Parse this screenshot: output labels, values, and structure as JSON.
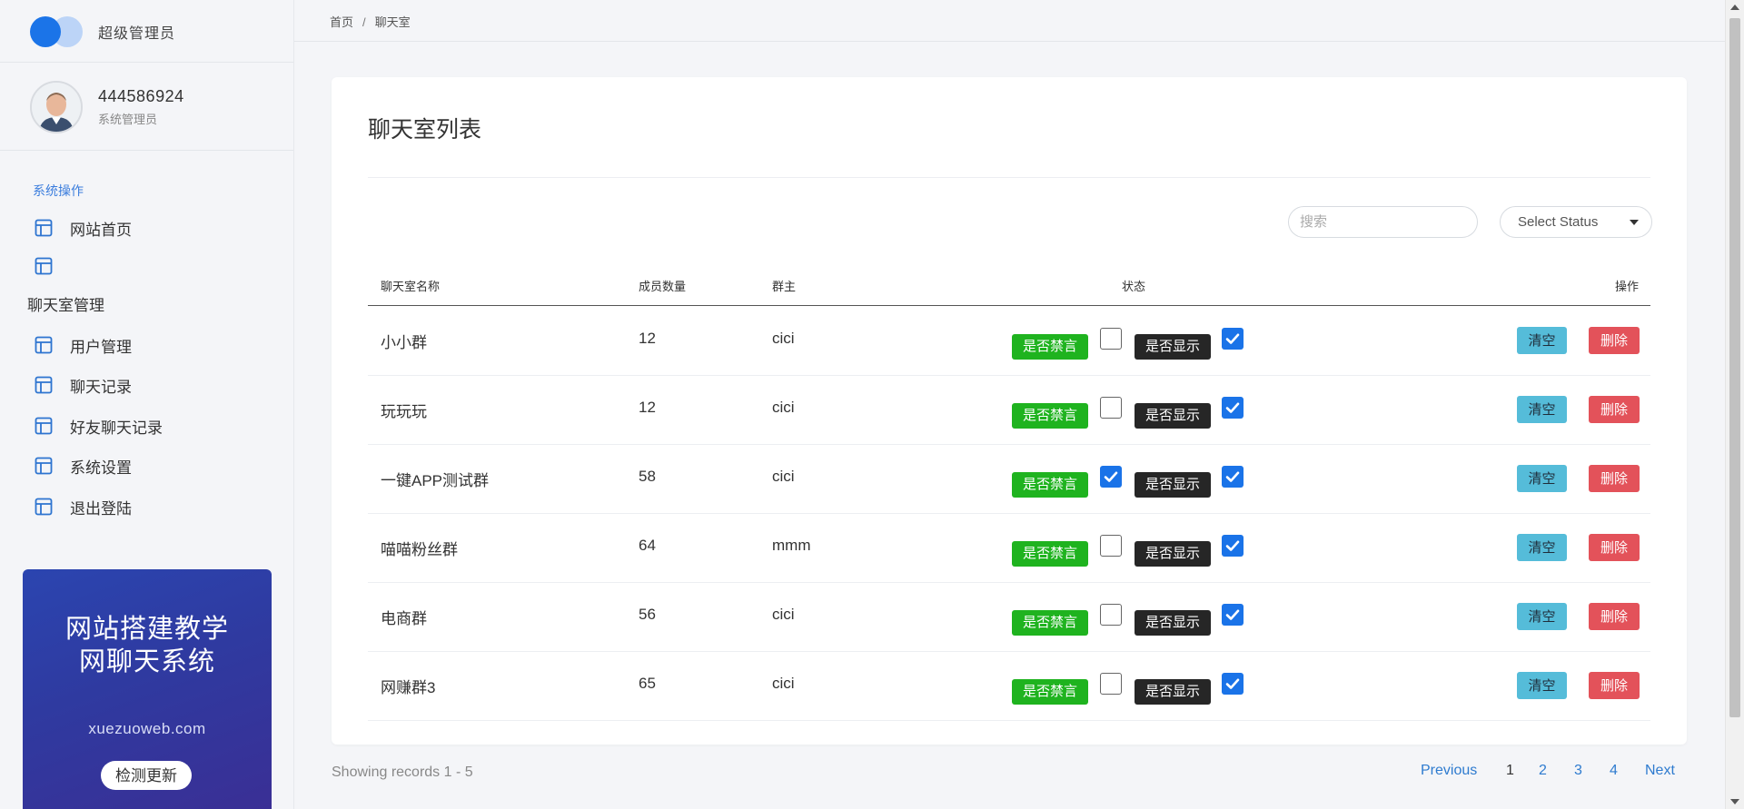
{
  "app": {
    "brand_text": "超级管理员"
  },
  "user": {
    "id": "444586924",
    "role": "系统管理员"
  },
  "sidebar": {
    "section_title": "系统操作",
    "items_top": [
      {
        "label": "网站首页",
        "icon": "layout-icon"
      },
      {
        "label": "",
        "icon": "layout-icon"
      }
    ],
    "group_title": "聊天室管理",
    "items": [
      {
        "label": "用户管理",
        "icon": "layout-icon"
      },
      {
        "label": "聊天记录",
        "icon": "layout-icon"
      },
      {
        "label": "好友聊天记录",
        "icon": "layout-icon"
      },
      {
        "label": "系统设置",
        "icon": "layout-icon"
      },
      {
        "label": "退出登陆",
        "icon": "layout-icon"
      }
    ]
  },
  "promo": {
    "title": "网站搭建教学网聊天系统",
    "url": "xuezuoweb.com",
    "button": "检测更新"
  },
  "breadcrumb": {
    "home": "首页",
    "sep": "/",
    "current": "聊天室"
  },
  "card": {
    "title": "聊天室列表"
  },
  "search": {
    "placeholder": "搜索"
  },
  "status_select": {
    "value": "Select Status"
  },
  "table": {
    "headers": {
      "name": "聊天室名称",
      "members": "成员数量",
      "owner": "群主",
      "status": "状态",
      "actions": "操作"
    },
    "badge_mute": "是否禁言",
    "badge_show": "是否显示",
    "btn_clear": "清空",
    "btn_delete": "删除",
    "rows": [
      {
        "name": "小小群",
        "members": "12",
        "owner": "cici",
        "muted": false,
        "shown": true
      },
      {
        "name": "玩玩玩",
        "members": "12",
        "owner": "cici",
        "muted": false,
        "shown": true
      },
      {
        "name": "一键APP测试群",
        "members": "58",
        "owner": "cici",
        "muted": true,
        "shown": true
      },
      {
        "name": "喵喵粉丝群",
        "members": "64",
        "owner": "mmm",
        "muted": false,
        "shown": true
      },
      {
        "name": "电商群",
        "members": "56",
        "owner": "cici",
        "muted": false,
        "shown": true
      },
      {
        "name": "网赚群3",
        "members": "65",
        "owner": "cici",
        "muted": false,
        "shown": true
      }
    ]
  },
  "footer": {
    "records": "Showing records 1 - 5",
    "previous": "Previous",
    "pages": [
      "1",
      "2",
      "3",
      "4"
    ],
    "active_page": "1",
    "next": "Next"
  },
  "colors": {
    "accent": "#1b74e8",
    "mute_badge": "#1fb31f",
    "show_badge": "#262626",
    "clear_btn": "#55bcd9",
    "delete_btn": "#e3525a",
    "link": "#2e7bcf"
  }
}
